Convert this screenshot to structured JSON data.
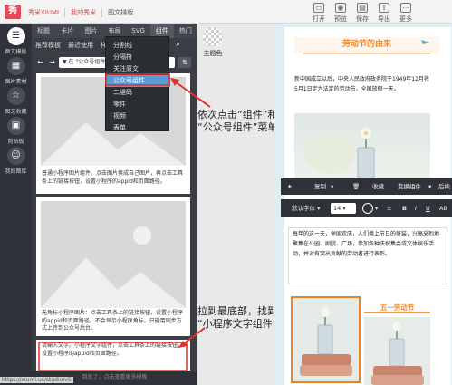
{
  "app": {
    "brand": "秀米XIUMI",
    "breadcrumbs": [
      "我的秀米",
      "图文排版"
    ]
  },
  "toolbar": [
    {
      "label": "打开",
      "icon": "folder-icon"
    },
    {
      "label": "预览",
      "icon": "preview-icon"
    },
    {
      "label": "保存",
      "icon": "save-icon"
    },
    {
      "label": "导出",
      "icon": "export-icon"
    },
    {
      "label": "更多",
      "icon": "more-icon"
    }
  ],
  "sidebar": [
    {
      "label": "图文模板",
      "icon": "template-icon",
      "active": true
    },
    {
      "label": "图片素材",
      "icon": "image-icon"
    },
    {
      "label": "图文收藏",
      "icon": "favorite-icon"
    },
    {
      "label": "剪贴板",
      "icon": "clipboard-icon"
    },
    {
      "label": "我的图库",
      "icon": "gallery-icon"
    }
  ],
  "panel": {
    "tabs1": [
      "标题",
      "卡片",
      "图片",
      "布局",
      "SVG",
      "组件",
      "热门"
    ],
    "tabs2": [
      "推荐模板",
      "最近使用",
      "样式"
    ],
    "filter": "在 \"公众号组件",
    "load_more": "到底了，点击查看更多模板"
  },
  "dropdown": [
    "分割线",
    "分隔符",
    "关注原文",
    "公众号组件",
    "二维码",
    "零件",
    "视频",
    "表单"
  ],
  "cards": [
    {
      "text": "普通小程序图片组件。点击图片换成自己图片，再点击工具条上的链接按钮，设置小程序的appid和页面路径。"
    },
    {
      "text": "无角标小程序图片：点击工具条上的链接按钮，设置小程序的appid和页面路径。不会显示小程序角标。只能用同步方式上传到公众号后台。"
    },
    {
      "text": "请输入文字。小程序文字组件，点击工具条上的链接按钮，设置小程序的appid和页面路径。"
    }
  ],
  "theme_label": "主题色",
  "annotations": {
    "step1_line1": "依次点击“组件”和",
    "step1_line2": "“公众号组件”菜单",
    "step2_line1": "拉到最底部，找到",
    "step2_line2": "“小程序文字组件”"
  },
  "article": {
    "title": "劳动节的由来",
    "para1": "新中国成立以后，中央人民政府政务院于1949年12月将5月1日定为法定的劳动节，全国放假一天。",
    "para2": "每年的这一天，举国欢庆，人们换上节日的盛装，兴高采烈地聚集在公园、剧院、广场，参加各种庆祝集会或文体娱乐活动，并对有突出贡献的劳动者进行表彰。",
    "caption": "五一劳动节"
  },
  "float_bar": [
    "复制",
    "收藏",
    "变换组件",
    "后续"
  ],
  "format_bar": {
    "font": "默认字体",
    "size": "14"
  },
  "url": "https://xiumi.us/studio/v5",
  "colors": {
    "accent": "#f08a2a",
    "brand": "#e34b57",
    "highlight": "#5b9bd5"
  }
}
